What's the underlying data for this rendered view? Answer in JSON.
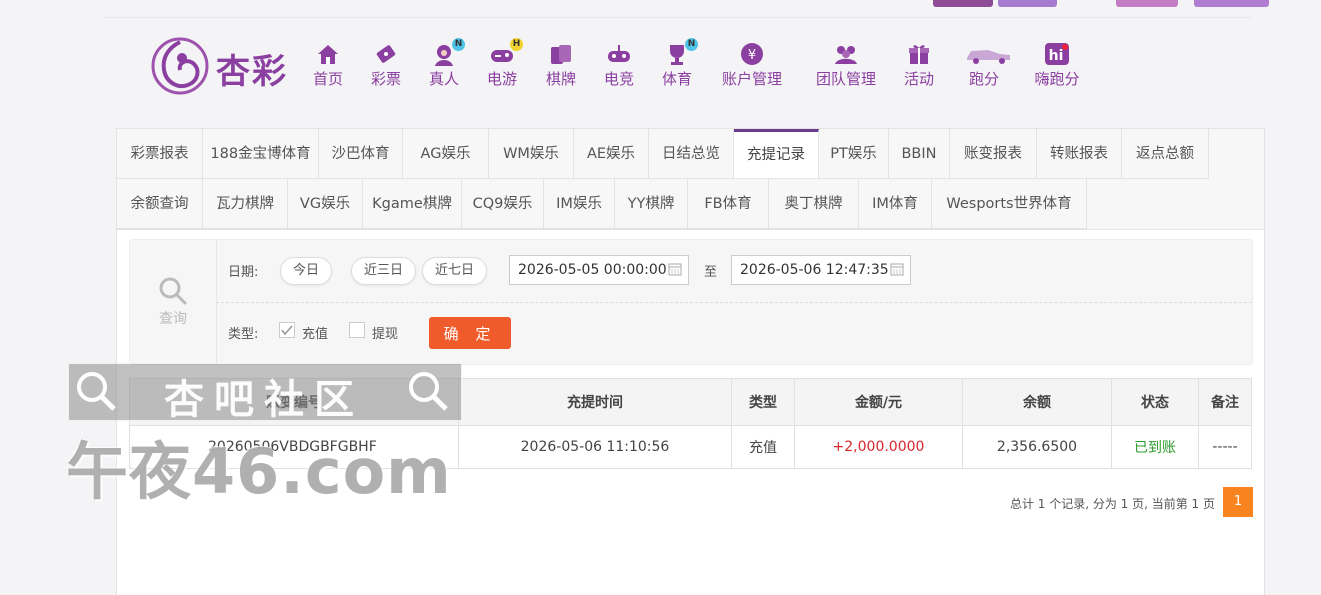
{
  "brand": {
    "name": "杏彩",
    "color": "#8b3fa0"
  },
  "nav": [
    {
      "label": "首页",
      "icon": "home-icon"
    },
    {
      "label": "彩票",
      "icon": "lottery-ticket-icon"
    },
    {
      "label": "真人",
      "icon": "live-dealer-icon",
      "badge": "N"
    },
    {
      "label": "电游",
      "icon": "gamepad-icon",
      "badge": "H"
    },
    {
      "label": "棋牌",
      "icon": "cards-icon"
    },
    {
      "label": "电竞",
      "icon": "esports-controller-icon"
    },
    {
      "label": "体育",
      "icon": "trophy-icon",
      "badge": "N"
    },
    {
      "label": "账户管理",
      "icon": "yen-coin-icon"
    },
    {
      "label": "团队管理",
      "icon": "team-icon"
    },
    {
      "label": "活动",
      "icon": "gift-icon"
    },
    {
      "label": "跑分",
      "icon": "car-icon"
    },
    {
      "label": "嗨跑分",
      "icon": "hi-logo-icon"
    }
  ],
  "tabs_row1": [
    "彩票报表",
    "188金宝博体育",
    "沙巴体育",
    "AG娱乐",
    "WM娱乐",
    "AE娱乐",
    "日结总览",
    "充提记录",
    "PT娱乐",
    "BBIN",
    "账变报表",
    "转账报表",
    "返点总额"
  ],
  "tabs_row2": [
    "余额查询",
    "瓦力棋牌",
    "VG娱乐",
    "Kgame棋牌",
    "CQ9娱乐",
    "IM娱乐",
    "YY棋牌",
    "FB体育",
    "奥丁棋牌",
    "IM体育",
    "Wesports世界体育"
  ],
  "active_tab": "充提记录",
  "query": {
    "title": "查询",
    "date_label": "日期:",
    "quick": [
      "今日",
      "近三日",
      "近七日"
    ],
    "start": "2026-05-05 00:00:00",
    "to": "至",
    "end": "2026-05-06 12:47:35",
    "type_label": "类型:",
    "types": [
      {
        "label": "充值",
        "checked": true
      },
      {
        "label": "提现",
        "checked": false
      }
    ],
    "confirm": "确 定"
  },
  "table": {
    "headers": [
      "账变编号",
      "充提时间",
      "类型",
      "金额/元",
      "余额",
      "状态",
      "备注"
    ],
    "rows": [
      {
        "id": "20260506VBDGBFGBHF",
        "time": "2026-05-06 11:10:56",
        "type": "充值",
        "amount": "+2,000.0000",
        "balance": "2,356.6500",
        "status": "已到账",
        "note": "-----"
      }
    ]
  },
  "pager": {
    "summary": "总计 1 个记录, 分为 1 页, 当前第 1 页",
    "page": "1"
  },
  "watermark": {
    "line1": "杏吧社区",
    "line2": "午夜46.com"
  },
  "colors": {
    "accent": "#8b3fa0",
    "confirm": "#ef5b2a",
    "amount": "#d9262c",
    "status_ok": "#2c9b2c",
    "page": "#f7841e"
  }
}
